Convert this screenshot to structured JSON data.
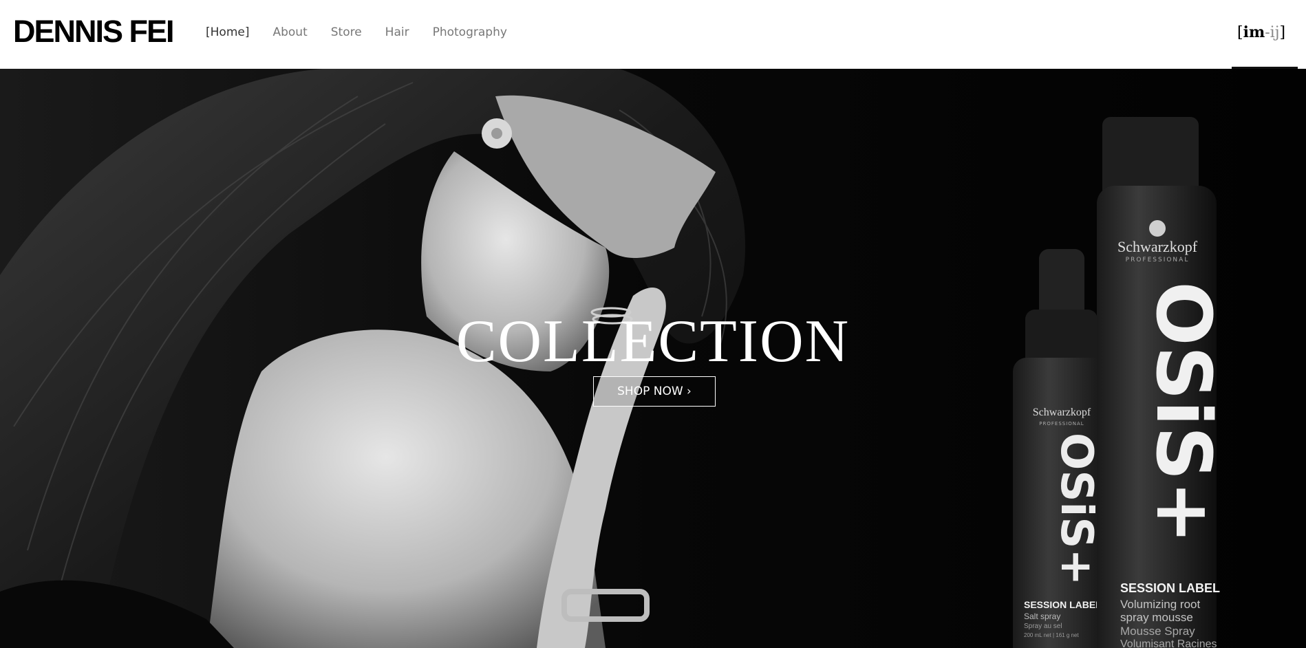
{
  "header": {
    "logo": "DENNIS FEI",
    "nav": [
      {
        "label": "[Home]"
      },
      {
        "label": "About"
      },
      {
        "label": "Store"
      },
      {
        "label": "Hair"
      },
      {
        "label": "Photography"
      }
    ],
    "lang_badge": {
      "open": "[",
      "bold": "im",
      "light": "-ij",
      "close": "]"
    }
  },
  "hero": {
    "title": "COLLECTION",
    "cta_label": "SHOP NOW ›",
    "product_small": {
      "brand": "Schwarzkopf",
      "sub": "PROFESSIONAL",
      "name": "SESSION LABEL",
      "line1": "Salt spray",
      "line2": "Spray au sel",
      "line3": "200 mL net | 161 g net"
    },
    "product_large": {
      "brand": "Schwarzkopf",
      "sub": "PROFESSIONAL",
      "name": "SESSION LABEL",
      "line1": "Volumizing root",
      "line2": "spray mousse",
      "line3": "Mousse Spray",
      "line4": "Volumisant Racines"
    },
    "product_logo": "OSiS+"
  },
  "colors": {
    "background": "#050505",
    "accent": "#ffffff",
    "nav_text": "#777777"
  }
}
